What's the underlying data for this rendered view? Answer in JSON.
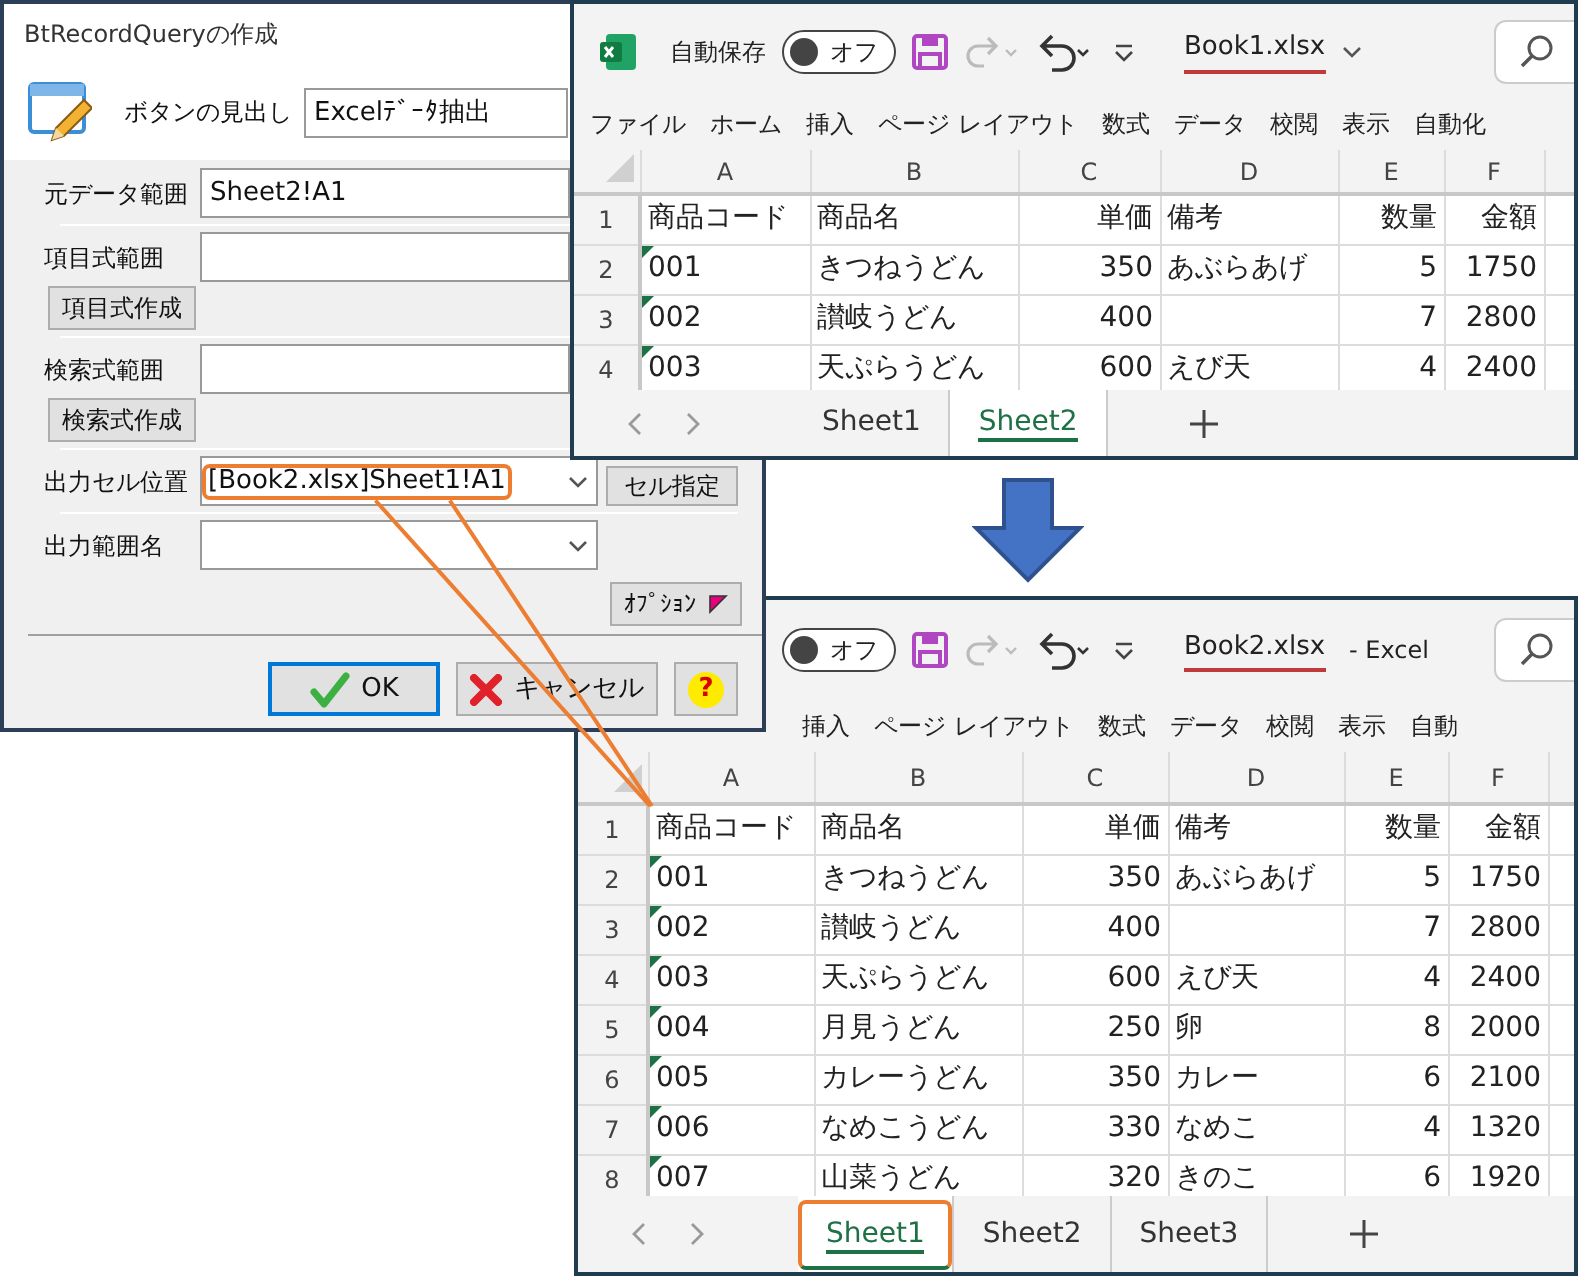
{
  "dialog": {
    "title": "BtRecordQueryの作成",
    "caption_label": "ボタンの見出し",
    "caption_value": "Excelﾃﾞｰﾀ抽出",
    "fields": [
      {
        "kind": "text",
        "label": "元データ範囲",
        "value": "Sheet2!A1",
        "highlighted": false
      },
      {
        "kind": "text",
        "label": "項目式範囲",
        "button": "項目式作成",
        "highlighted": false
      },
      {
        "kind": "text",
        "label": "検索式範囲",
        "button": "検索式作成",
        "highlighted": false
      },
      {
        "kind": "combo",
        "label": "出力セル位置",
        "value": "[Book2.xlsx]Sheet1!A1",
        "side_button": "セル指定",
        "highlighted": true
      },
      {
        "kind": "combo",
        "label": "出力範囲名",
        "highlighted": false
      }
    ],
    "options_button": "ｵﾌﾟｼｮﾝ",
    "buttons": [
      {
        "kind": "ok",
        "label": "OK",
        "default": true
      },
      {
        "kind": "cancel",
        "label": "キャンセル",
        "default": false
      },
      {
        "kind": "help",
        "label": "?",
        "default": false
      }
    ]
  },
  "workbooks": [
    {
      "autosave_label": "自動保存",
      "autosave_on": false,
      "autosave_state": "オフ",
      "file_name": "Book1.xlsx",
      "dropdown": true,
      "ribbon_tabs": [
        "ファイル",
        "ホーム",
        "挿入",
        "ページ レイアウト",
        "数式",
        "データ",
        "校閲",
        "表示",
        "自動化"
      ],
      "columns": [
        {
          "label": "A",
          "numeric": false
        },
        {
          "label": "B",
          "numeric": false
        },
        {
          "label": "C",
          "numeric": true
        },
        {
          "label": "D",
          "numeric": false
        },
        {
          "label": "E",
          "numeric": true
        },
        {
          "label": "F",
          "numeric": true
        }
      ],
      "rows": [
        {
          "number": "1",
          "flagged": false,
          "cells": [
            "商品コード",
            "商品名",
            "単価",
            "備考",
            "数量",
            "金額"
          ]
        },
        {
          "number": "2",
          "flagged": true,
          "cells": [
            "001",
            "きつねうどん",
            "350",
            "あぶらあげ",
            "5",
            "1750"
          ]
        },
        {
          "number": "3",
          "flagged": true,
          "cells": [
            "002",
            "讃岐うどん",
            "400",
            "",
            "7",
            "2800"
          ]
        },
        {
          "number": "4",
          "flagged": true,
          "cells": [
            "003",
            "天ぷらうどん",
            "600",
            "えび天",
            "4",
            "2400"
          ]
        }
      ],
      "sheets": [
        {
          "label": "Sheet1",
          "selected": false,
          "highlighted": false
        },
        {
          "label": "Sheet2",
          "selected": true,
          "highlighted": false
        }
      ]
    },
    {
      "autosave_on": false,
      "autosave_state": "オフ",
      "file_name": "Book2.xlsx",
      "dropdown": false,
      "title_suffix": "-  Excel",
      "ribbon_tabs": [
        "挿入",
        "ページ レイアウト",
        "数式",
        "データ",
        "校閲",
        "表示",
        "自動"
      ],
      "columns": [
        {
          "label": "A",
          "numeric": false
        },
        {
          "label": "B",
          "numeric": false
        },
        {
          "label": "C",
          "numeric": true
        },
        {
          "label": "D",
          "numeric": false
        },
        {
          "label": "E",
          "numeric": true
        },
        {
          "label": "F",
          "numeric": true
        }
      ],
      "rows": [
        {
          "number": "1",
          "flagged": false,
          "cells": [
            "商品コード",
            "商品名",
            "単価",
            "備考",
            "数量",
            "金額"
          ]
        },
        {
          "number": "2",
          "flagged": true,
          "cells": [
            "001",
            "きつねうどん",
            "350",
            "あぶらあげ",
            "5",
            "1750"
          ]
        },
        {
          "number": "3",
          "flagged": true,
          "cells": [
            "002",
            "讃岐うどん",
            "400",
            "",
            "7",
            "2800"
          ]
        },
        {
          "number": "4",
          "flagged": true,
          "cells": [
            "003",
            "天ぷらうどん",
            "600",
            "えび天",
            "4",
            "2400"
          ]
        },
        {
          "number": "5",
          "flagged": true,
          "cells": [
            "004",
            "月見うどん",
            "250",
            "卵",
            "8",
            "2000"
          ]
        },
        {
          "number": "6",
          "flagged": true,
          "cells": [
            "005",
            "カレーうどん",
            "350",
            "カレー",
            "6",
            "2100"
          ]
        },
        {
          "number": "7",
          "flagged": true,
          "cells": [
            "006",
            "なめこうどん",
            "330",
            "なめこ",
            "4",
            "1320"
          ]
        },
        {
          "number": "8",
          "flagged": true,
          "cells": [
            "007",
            "山菜うどん",
            "320",
            "きのこ",
            "6",
            "1920"
          ]
        }
      ],
      "sheets": [
        {
          "label": "Sheet1",
          "selected": true,
          "highlighted": true
        },
        {
          "label": "Sheet2",
          "selected": false,
          "highlighted": false
        },
        {
          "label": "Sheet3",
          "selected": false,
          "highlighted": false
        }
      ]
    }
  ]
}
